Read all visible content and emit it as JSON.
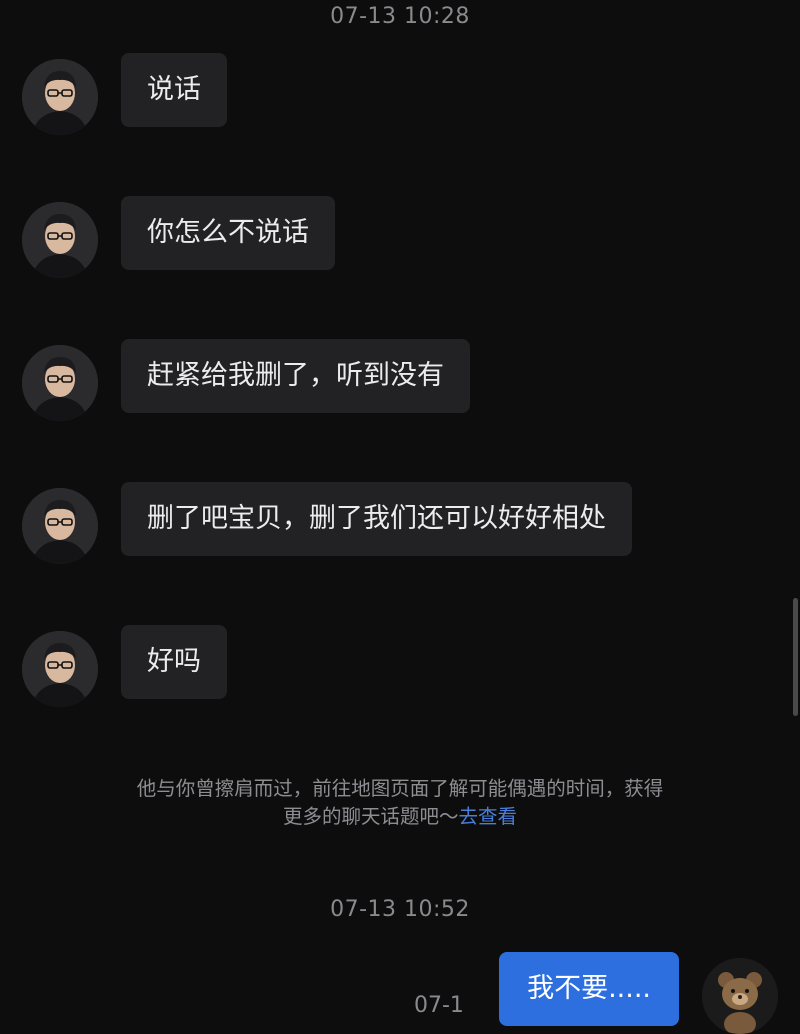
{
  "timestamps": {
    "first": "07-13 10:28",
    "second": "07-13 10:52",
    "partial": "07-1"
  },
  "messages": [
    {
      "text": "说话"
    },
    {
      "text": "你怎么不说话"
    },
    {
      "text": "赶紧给我删了，听到没有"
    },
    {
      "text": "删了吧宝贝，删了我们还可以好好相处"
    },
    {
      "text": "好吗"
    }
  ],
  "hint": {
    "line1": "他与你曾擦肩而过，前往地图页面了解可能偶遇的时间，获得",
    "line2_prefix": "更多的聊天话题吧～",
    "link": "去查看"
  },
  "self_message": {
    "text": "我不要....."
  },
  "icons": {
    "contact_avatar": "man-with-glasses-avatar-icon",
    "self_avatar": "bear-avatar-icon"
  },
  "colors": {
    "background": "#0d0d0e",
    "bubble_other": "#222224",
    "bubble_self": "#2e6fe0",
    "link": "#4b7ed8"
  }
}
